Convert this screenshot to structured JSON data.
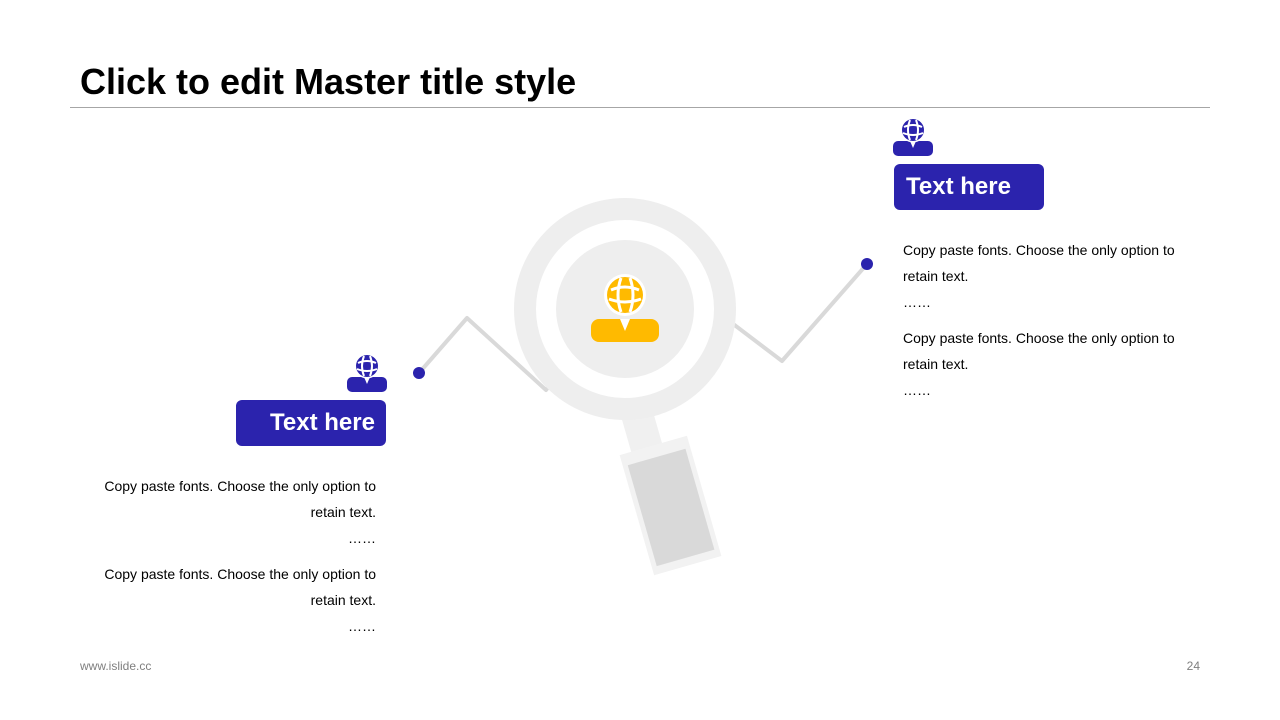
{
  "slide": {
    "title": "Click to edit Master title style",
    "footer_url": "www.islide.cc",
    "page_number": "24"
  },
  "colors": {
    "accent_blue": "#2b23ad",
    "accent_yellow": "#ffba00",
    "line_gray": "#d9d9d9",
    "lens_gray": "#eeeeee"
  },
  "icons": {
    "center": "globe-person-icon",
    "markers": "globe-person-icon"
  },
  "left_block": {
    "label": "Text here",
    "paragraphs": [
      {
        "text": "Copy paste fonts. Choose the only option to retain text.",
        "ellipsis": "……"
      },
      {
        "text": "Copy paste fonts. Choose the only option to retain text.",
        "ellipsis": "……"
      }
    ]
  },
  "right_block": {
    "label": "Text here",
    "paragraphs": [
      {
        "text": "Copy paste fonts. Choose the only option to retain text.",
        "ellipsis": "……"
      },
      {
        "text": "Copy paste fonts. Choose the only option to retain text.",
        "ellipsis": "……"
      }
    ]
  }
}
